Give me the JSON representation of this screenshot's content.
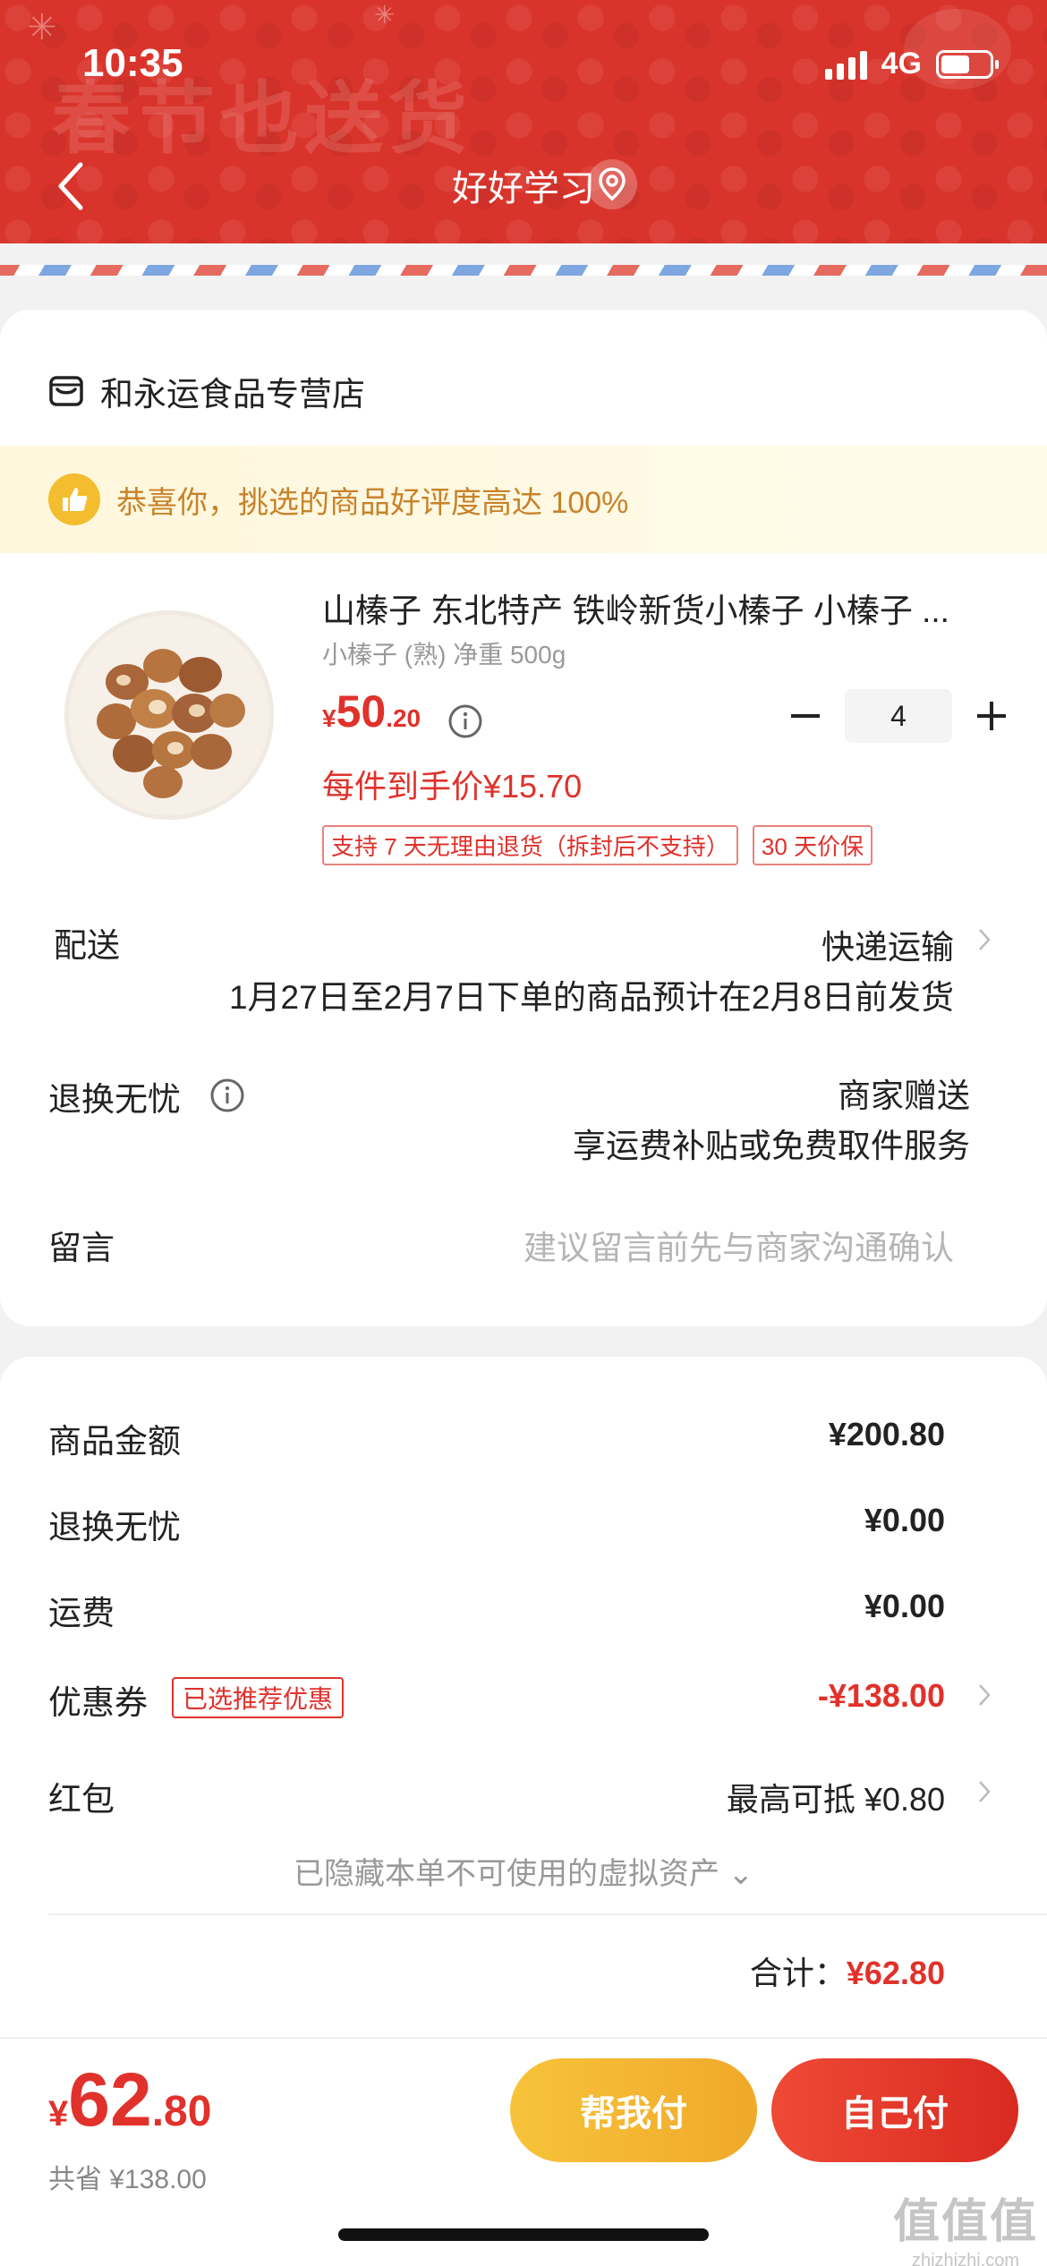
{
  "status_bar": {
    "time": "10:35",
    "network": "4G"
  },
  "header": {
    "banner_text": "春节也送货",
    "title": "好好学习"
  },
  "shop": {
    "name": "和永运食品专营店"
  },
  "promo": {
    "text": "恭喜你，挑选的商品好评度高达 100%"
  },
  "product": {
    "title": "山榛子 东北特产 铁岭新货小榛子 小榛子 ...",
    "spec": "小榛子 (熟) 净重 500g",
    "price_currency": "¥",
    "price_int": "50",
    "price_dec": ".20",
    "quantity": "4",
    "final_price": "每件到手价¥15.70",
    "tags": [
      "支持 7 天无理由退货（拆封后不支持）",
      "30 天价保"
    ]
  },
  "delivery": {
    "label": "配送",
    "method": "快递运输",
    "note": "1月27日至2月7日下单的商品预计在2月8日前发货"
  },
  "return_service": {
    "label": "退换无忧",
    "line1": "商家赠送",
    "line2": "享运费补贴或免费取件服务"
  },
  "message": {
    "label": "留言",
    "placeholder": "建议留言前先与商家沟通确认"
  },
  "fees": {
    "goods_label": "商品金额",
    "goods_value": "¥200.80",
    "return_label": "退换无忧",
    "return_value": "¥0.00",
    "shipping_label": "运费",
    "shipping_value": "¥0.00",
    "coupon_label": "优惠券",
    "coupon_tag": "已选推荐优惠",
    "coupon_value": "-¥138.00",
    "redpacket_label": "红包",
    "redpacket_value": "最高可抵 ¥0.80",
    "hidden_assets": "已隐藏本单不可使用的虚拟资产 ⌄",
    "total_label": "合计：",
    "total_value": "¥62.80"
  },
  "bottom_bar": {
    "currency": "¥",
    "price_int": "62",
    "price_dec": ".80",
    "saved": "共省 ¥138.00",
    "help_pay": "帮我付",
    "self_pay": "自己付"
  },
  "watermark": {
    "main": "值值值",
    "sub": "zhizhizhi.com"
  },
  "colors": {
    "brand_red": "#e0312b",
    "header_red": "#d9342b",
    "promo_gold": "#c8822a",
    "help_btn": "#f7c33a"
  }
}
